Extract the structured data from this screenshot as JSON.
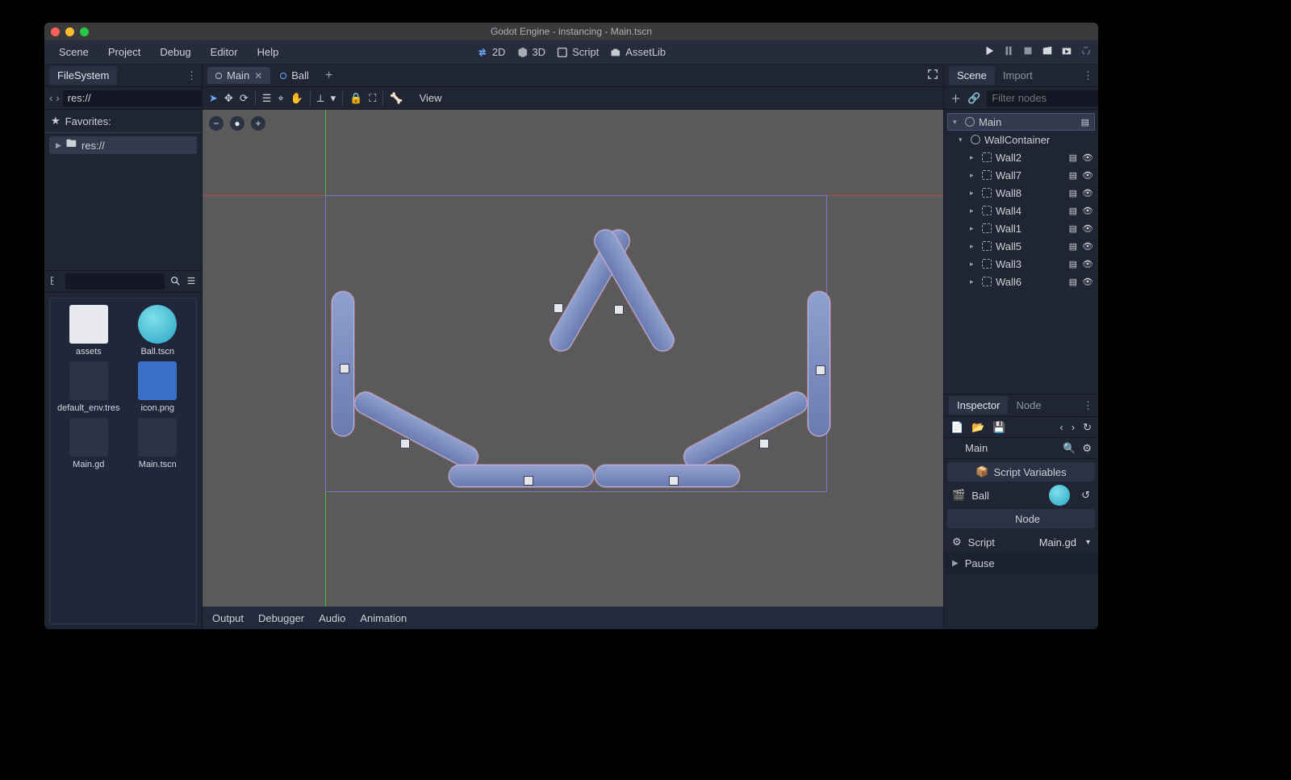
{
  "window": {
    "title": "Godot Engine - instancing - Main.tscn"
  },
  "menubar": {
    "items": [
      "Scene",
      "Project",
      "Debug",
      "Editor",
      "Help"
    ]
  },
  "workspace": {
    "items": [
      "2D",
      "3D",
      "Script",
      "AssetLib"
    ],
    "active": "2D"
  },
  "filesystem": {
    "tab": "FileSystem",
    "path": "res://",
    "favorites_label": "Favorites:",
    "tree_root": "res://",
    "grid": [
      {
        "label": "assets",
        "kind": "folder"
      },
      {
        "label": "Ball.tscn",
        "kind": "ball"
      },
      {
        "label": "default_env.tres",
        "kind": "dark"
      },
      {
        "label": "icon.png",
        "kind": "godot"
      },
      {
        "label": "Main.gd",
        "kind": "dark"
      },
      {
        "label": "Main.tscn",
        "kind": "dark"
      }
    ]
  },
  "scene_tabs": {
    "tabs": [
      {
        "label": "Main",
        "active": true,
        "closable": true
      },
      {
        "label": "Ball",
        "active": false,
        "closable": false
      }
    ]
  },
  "viewport": {
    "view_label": "View"
  },
  "bottom": {
    "tabs": [
      "Output",
      "Debugger",
      "Audio",
      "Animation"
    ]
  },
  "scene_dock": {
    "tabs": {
      "scene": "Scene",
      "import": "Import"
    },
    "filter_placeholder": "Filter nodes",
    "root": "Main",
    "container": "WallContainer",
    "walls": [
      "Wall2",
      "Wall7",
      "Wall8",
      "Wall4",
      "Wall1",
      "Wall5",
      "Wall3",
      "Wall6"
    ]
  },
  "inspector": {
    "tabs": {
      "inspector": "Inspector",
      "node": "Node"
    },
    "object": "Main",
    "section_script_vars": "Script Variables",
    "prop_ball": "Ball",
    "section_node": "Node",
    "prop_script": "Script",
    "script_value": "Main.gd",
    "pause": "Pause"
  }
}
